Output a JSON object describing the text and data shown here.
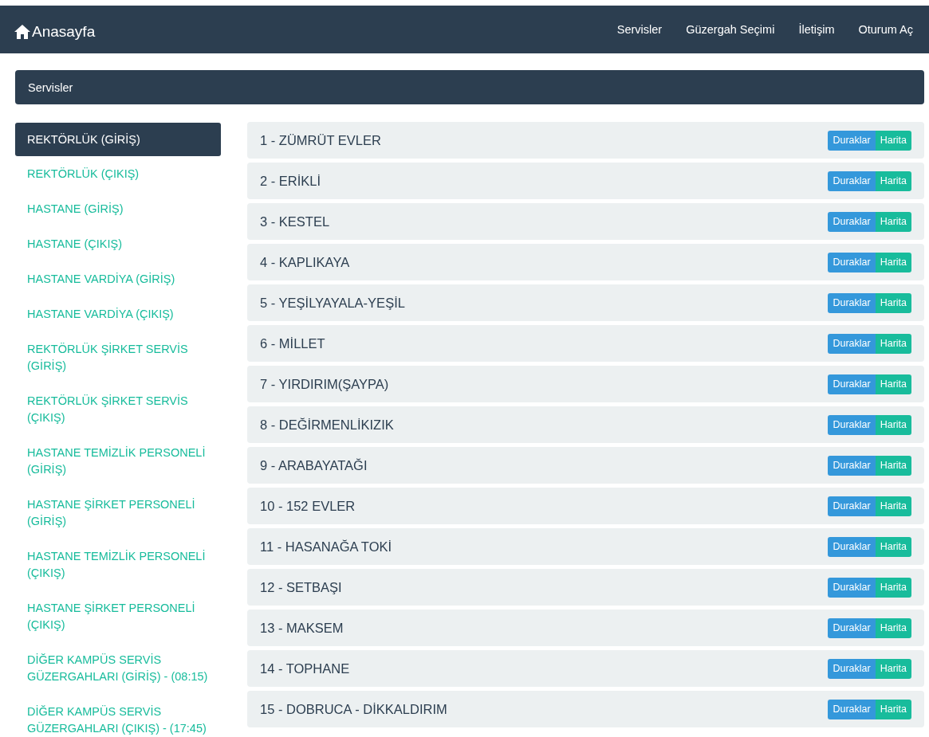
{
  "navbar": {
    "brand": "Anasayfa",
    "links": [
      "Servisler",
      "Güzergah Seçimi",
      "İletişim",
      "Oturum Aç"
    ]
  },
  "panel": {
    "title": "Servisler"
  },
  "sidebar": {
    "items": [
      {
        "label": "REKTÖRLÜK (GİRİŞ)",
        "selected": true
      },
      {
        "label": "REKTÖRLÜK (ÇIKIŞ)",
        "selected": false
      },
      {
        "label": "HASTANE (GİRİŞ)",
        "selected": false
      },
      {
        "label": "HASTANE (ÇIKIŞ)",
        "selected": false
      },
      {
        "label": "HASTANE VARDİYA (GİRİŞ)",
        "selected": false
      },
      {
        "label": "HASTANE VARDİYA (ÇIKIŞ)",
        "selected": false
      },
      {
        "label": "REKTÖRLÜK ŞİRKET SERVİS (GİRİŞ)",
        "selected": false
      },
      {
        "label": "REKTÖRLÜK ŞİRKET SERVİS (ÇIKIŞ)",
        "selected": false
      },
      {
        "label": "HASTANE TEMİZLİK PERSONELİ (GİRİŞ)",
        "selected": false
      },
      {
        "label": "HASTANE ŞİRKET PERSONELİ (GİRİŞ)",
        "selected": false
      },
      {
        "label": "HASTANE TEMİZLİK PERSONELİ (ÇIKIŞ)",
        "selected": false
      },
      {
        "label": "HASTANE ŞİRKET PERSONELİ (ÇIKIŞ)",
        "selected": false
      },
      {
        "label": "DİĞER KAMPÜS SERVİS GÜZERGAHLARI (GİRİŞ) - (08:15)",
        "selected": false
      },
      {
        "label": "DİĞER KAMPÜS SERVİS GÜZERGAHLARI (ÇIKIŞ) - (17:45)",
        "selected": false
      }
    ]
  },
  "routes": [
    {
      "name": "1 - ZÜMRÜT EVLER",
      "stops_button": "Duraklar",
      "map_button": "Harita"
    },
    {
      "name": "2 - ERİKLİ",
      "stops_button": "Duraklar",
      "map_button": "Harita"
    },
    {
      "name": "3 - KESTEL",
      "stops_button": "Duraklar",
      "map_button": "Harita"
    },
    {
      "name": "4 - KAPLIKAYA",
      "stops_button": "Duraklar",
      "map_button": "Harita"
    },
    {
      "name": "5 - YEŞİLYAYALA-YEŞİL",
      "stops_button": "Duraklar",
      "map_button": "Harita"
    },
    {
      "name": "6 - MİLLET",
      "stops_button": "Duraklar",
      "map_button": "Harita"
    },
    {
      "name": "7 - YIRDIRIM(ŞAYPA)",
      "stops_button": "Duraklar",
      "map_button": "Harita"
    },
    {
      "name": "8 - DEĞİRMENLİKIZIK",
      "stops_button": "Duraklar",
      "map_button": "Harita"
    },
    {
      "name": "9 - ARABAYATAĞI",
      "stops_button": "Duraklar",
      "map_button": "Harita"
    },
    {
      "name": "10 - 152 EVLER",
      "stops_button": "Duraklar",
      "map_button": "Harita"
    },
    {
      "name": "11 - HASANAĞA TOKİ",
      "stops_button": "Duraklar",
      "map_button": "Harita"
    },
    {
      "name": "12 - SETBAŞI",
      "stops_button": "Duraklar",
      "map_button": "Harita"
    },
    {
      "name": "13 - MAKSEM",
      "stops_button": "Duraklar",
      "map_button": "Harita"
    },
    {
      "name": "14 - TOPHANE",
      "stops_button": "Duraklar",
      "map_button": "Harita"
    },
    {
      "name": "15 - DOBRUCA - DİKKALDIRIM",
      "stops_button": "Duraklar",
      "map_button": "Harita"
    }
  ]
}
